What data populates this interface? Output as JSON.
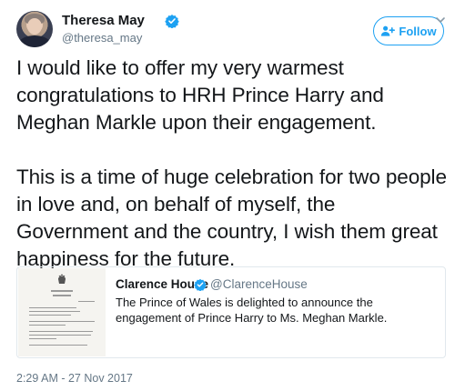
{
  "author": {
    "name": "Theresa May",
    "handle": "@theresa_may",
    "verified": true,
    "avatar_icon": "profile-photo"
  },
  "follow_button": {
    "label": "Follow",
    "icon": "add-user-icon",
    "accent_color": "#1da1f2"
  },
  "tweet": {
    "paragraphs": [
      "I would like to offer my very warmest congratulations to HRH Prince Harry and Meghan Markle upon their engagement.",
      "This is a time of huge celebration for two people in love and, on behalf of myself, the Government and the country, I wish them great happiness for the future."
    ],
    "timestamp": "2:29 AM - 27 Nov 2017"
  },
  "quoted_tweet": {
    "author": "Clarence House",
    "handle": "@ClarenceHouse",
    "verified": true,
    "text": "The Prince of Wales is delighted to announce the engagement of Prince Harry to Ms. Meghan Markle.",
    "thumbnail_icon": "announcement-document-thumbnail"
  },
  "colors": {
    "text": "#14171a",
    "secondary": "#657786",
    "verified": "#1da1f2",
    "border": "#e1e8ed"
  }
}
